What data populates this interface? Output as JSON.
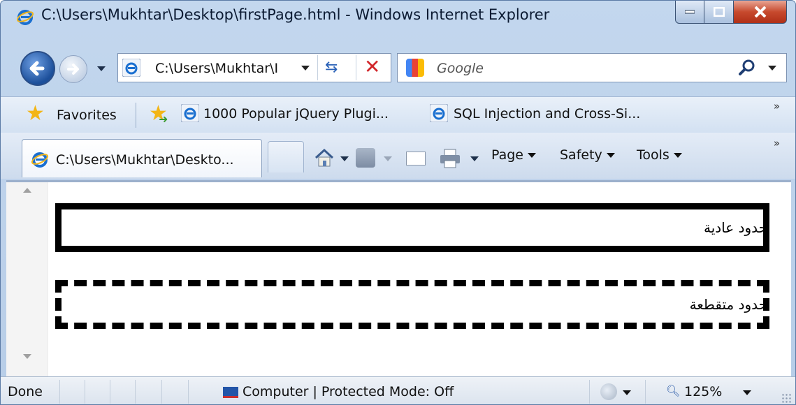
{
  "window": {
    "title": "C:\\Users\\Mukhtar\\Desktop\\firstPage.html - Windows Internet Explorer",
    "accent": "#1c4f9a"
  },
  "navigation": {
    "address": "C:\\Users\\Mukhtar\\I",
    "search_placeholder": "Google"
  },
  "favorites_bar": {
    "favorites_label": "Favorites",
    "items": [
      {
        "label": "1000 Popular jQuery Plugi..."
      },
      {
        "label": "SQL Injection and Cross-Si..."
      }
    ],
    "overflow": "»"
  },
  "command_bar": {
    "active_tab": "C:\\Users\\Mukhtar\\Deskto...",
    "menus": [
      {
        "label": "Page"
      },
      {
        "label": "Safety"
      },
      {
        "label": "Tools"
      }
    ],
    "overflow": "»"
  },
  "page": {
    "boxes": [
      {
        "text": "حدود عادية",
        "style": "solid"
      },
      {
        "text": "حدود متقطعة",
        "style": "dashed"
      }
    ]
  },
  "status_bar": {
    "status": "Done",
    "zone": "Computer | Protected Mode: Off",
    "zoom": "125%"
  }
}
